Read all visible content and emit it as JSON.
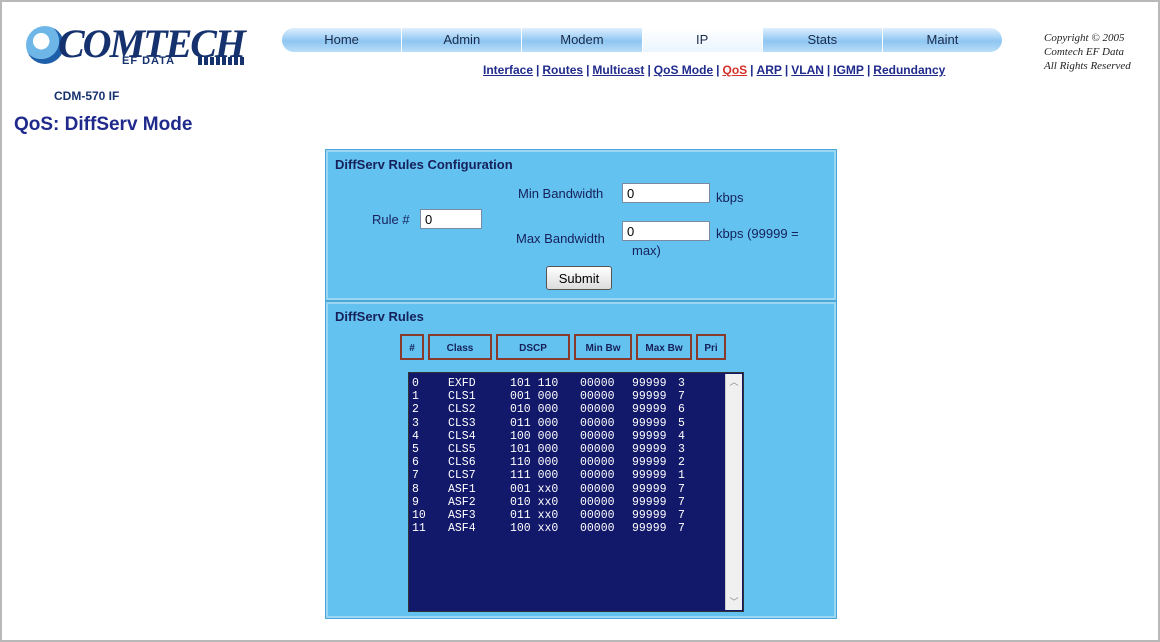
{
  "header": {
    "brand": "COMTECH",
    "brand_sub": "EF DATA",
    "model": "CDM-570 IF",
    "copyright": [
      "Copyright © 2005",
      "Comtech EF Data",
      "All Rights Reserved"
    ]
  },
  "tabs": [
    "Home",
    "Admin",
    "Modem",
    "IP",
    "Stats",
    "Maint"
  ],
  "active_tab": "IP",
  "subnav": [
    "Interface",
    "Routes",
    "Multicast",
    "QoS Mode",
    "QoS",
    "ARP",
    "VLAN",
    "IGMP",
    "Redundancy"
  ],
  "active_subnav": "QoS",
  "page_title": "QoS: DiffServ Mode",
  "config": {
    "title": "DiffServ Rules Configuration",
    "rule_label": "Rule #",
    "rule_value": "0",
    "min_bw_label": "Min Bandwidth",
    "min_bw_value": "0",
    "min_bw_unit": "kbps",
    "max_bw_label": "Max Bandwidth",
    "max_bw_value": "0",
    "max_bw_unit": "kbps (99999 =",
    "max_bw_unit2": "max)",
    "submit": "Submit"
  },
  "rules": {
    "title": "DiffServ Rules",
    "columns": [
      "#",
      "Class",
      "DSCP",
      "Min Bw",
      "Max Bw",
      "Pri"
    ],
    "rows": [
      [
        "0",
        "EXFD",
        "101 110",
        "00000",
        "99999",
        "3"
      ],
      [
        "1",
        "CLS1",
        "001 000",
        "00000",
        "99999",
        "7"
      ],
      [
        "2",
        "CLS2",
        "010 000",
        "00000",
        "99999",
        "6"
      ],
      [
        "3",
        "CLS3",
        "011 000",
        "00000",
        "99999",
        "5"
      ],
      [
        "4",
        "CLS4",
        "100 000",
        "00000",
        "99999",
        "4"
      ],
      [
        "5",
        "CLS5",
        "101 000",
        "00000",
        "99999",
        "3"
      ],
      [
        "6",
        "CLS6",
        "110 000",
        "00000",
        "99999",
        "2"
      ],
      [
        "7",
        "CLS7",
        "111 000",
        "00000",
        "99999",
        "1"
      ],
      [
        "8",
        "ASF1",
        "001 xx0",
        "00000",
        "99999",
        "7"
      ],
      [
        "9",
        "ASF2",
        "010 xx0",
        "00000",
        "99999",
        "7"
      ],
      [
        "10",
        "ASF3",
        "011 xx0",
        "00000",
        "99999",
        "7"
      ],
      [
        "11",
        "ASF4",
        "100 xx0",
        "00000",
        "99999",
        "7"
      ]
    ]
  },
  "colors": {
    "panel": "#63c2ef",
    "listbox_bg": "#12186a",
    "title_text": "#1f2a8c",
    "active_link": "#d4302a"
  }
}
